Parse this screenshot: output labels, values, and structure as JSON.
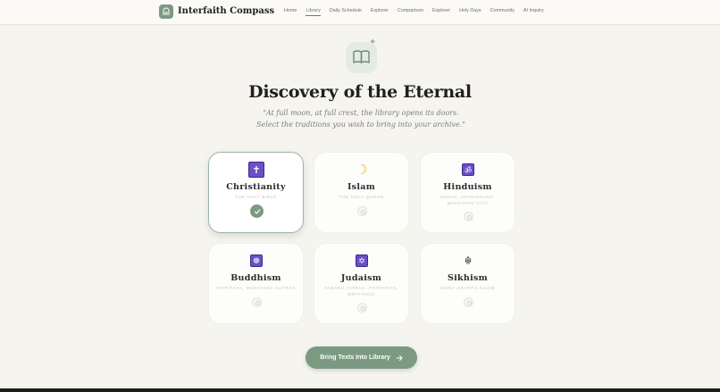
{
  "brand": {
    "name": "Interfaith Compass"
  },
  "nav": {
    "links": [
      {
        "label": "Home",
        "active": false
      },
      {
        "label": "Library",
        "active": true
      },
      {
        "label": "Daily Schedule",
        "active": false
      },
      {
        "label": "Explorer",
        "active": false
      },
      {
        "label": "Comparison",
        "active": false
      },
      {
        "label": "Explorer",
        "active": false
      },
      {
        "label": "Holy Days",
        "active": false
      },
      {
        "label": "Community",
        "active": false
      },
      {
        "label": "AI Inquiry",
        "active": false
      }
    ]
  },
  "hero": {
    "title": "Discovery of the Eternal",
    "subtitle": "\"At full moon, at full crest, the library opens its doors. Select the traditions you wish to bring into your archive.\""
  },
  "traditions": [
    {
      "name": "Christianity",
      "text": "The Holy Bible",
      "selected": true,
      "icon": "cross-icon"
    },
    {
      "name": "Islam",
      "text": "The Holy Quran",
      "selected": false,
      "icon": "crescent-moon-icon"
    },
    {
      "name": "Hinduism",
      "text": "Vedas, Upanishads, Bhagavad Gita",
      "selected": false,
      "icon": "om-icon"
    },
    {
      "name": "Buddhism",
      "text": "Tripitaka, Mahayana Sutras",
      "selected": false,
      "icon": "dharma-wheel-icon"
    },
    {
      "name": "Judaism",
      "text": "Tanakh (Torah, Prophets, Writings)",
      "selected": false,
      "icon": "star-of-david-icon"
    },
    {
      "name": "Sikhism",
      "text": "Guru Granth Sahib",
      "selected": false,
      "icon": "khanda-icon"
    }
  ],
  "cta": {
    "label": "Bring Texts Into Library"
  },
  "colors": {
    "accent": "#7c9a82",
    "background": "#f5f4ef",
    "emblem": "#6a4fc7"
  }
}
